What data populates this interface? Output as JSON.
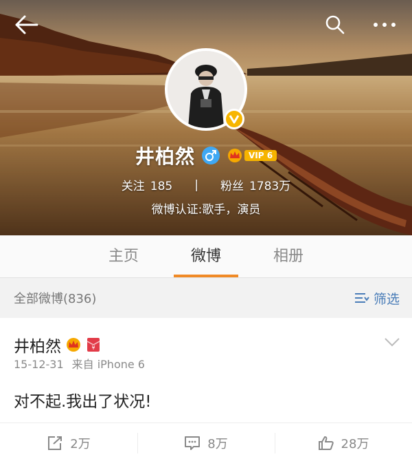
{
  "profile": {
    "name": "井柏然",
    "vip_label": "VIP 6",
    "following_label": "关注",
    "following_count": "185",
    "separator": "|",
    "followers_label": "粉丝",
    "followers_count": "1783万",
    "verification": "微博认证:歌手，演员"
  },
  "tabs": [
    {
      "label": "主页",
      "active": false
    },
    {
      "label": "微博",
      "active": true
    },
    {
      "label": "相册",
      "active": false
    }
  ],
  "filter": {
    "count_text": "全部微博(836)",
    "filter_label": "筛选"
  },
  "post": {
    "author": "井柏然",
    "date": "15-12-31",
    "source": "来自 iPhone 6",
    "text": "对不起.我出了状况!",
    "reposts": "2万",
    "comments": "8万",
    "likes": "28万"
  },
  "colors": {
    "accent": "#f08a26",
    "link": "#4a7db8",
    "verified": "#f7b500",
    "gender": "#3fa8f4"
  },
  "icons": [
    "back-arrow-icon",
    "search-icon",
    "more-icon",
    "verified-icon",
    "male-icon",
    "crown-icon",
    "red-envelope-icon",
    "filter-icon",
    "chevron-down-icon",
    "repost-icon",
    "comment-icon",
    "like-icon"
  ]
}
